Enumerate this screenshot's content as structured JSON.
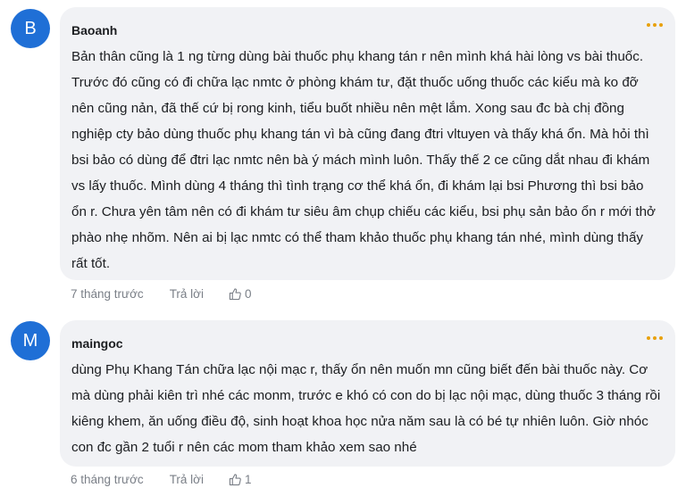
{
  "comments": [
    {
      "avatar_letter": "B",
      "author": "Baoanh",
      "text": "Bản thân cũng là 1 ng từng dùng bài thuốc phụ khang tán r nên mình khá hài lòng vs bài thuốc. Trước đó cũng có đi chữa lạc nmtc ở phòng khám tư, đặt thuốc uống thuốc các kiểu mà ko đỡ nên cũng nản, đã thế cứ bị rong kinh, tiểu buốt nhiều nên mệt lắm. Xong sau đc bà chị đồng nghiệp cty bảo dùng thuốc phụ khang tán vì bà cũng đang đtri vltuyen và thấy khá ổn. Mà hỏi thì bsi bảo có dùng để đtri lạc nmtc nên bà ý mách mình luôn. Thấy thế 2 ce cũng dắt nhau đi khám vs lấy thuốc. Mình dùng 4 tháng thì tình trạng cơ thể khá ổn, đi khám lại bsi Phương thì bsi bảo ổn r. Chưa yên tâm nên có đi khám tư siêu âm chụp chiếu các kiểu, bsi phụ sản bảo ổn r mới thở phào nhẹ nhõm. Nên ai bị lạc nmtc có thể tham khảo thuốc phụ khang tán nhé, mình dùng thấy rất tốt.",
      "time": "7 tháng trước",
      "reply_label": "Trả lời",
      "likes": "0"
    },
    {
      "avatar_letter": "M",
      "author": "maingoc",
      "text": "dùng Phụ Khang Tán chữa lạc nội mạc r, thấy ổn nên muốn mn cũng biết đến bài thuốc này. Cơ mà dùng phải kiên trì nhé các monm, trước e khó có con do bị lạc nội mạc, dùng thuốc 3 tháng rồi kiêng khem, ăn uống điều độ, sinh hoạt khoa học nửa năm sau là có bé tự nhiên luôn. Giờ nhóc con đc gần 2 tuổi r nên các mom tham khảo xem sao nhé",
      "time": "6 tháng trước",
      "reply_label": "Trả lời",
      "likes": "1"
    }
  ],
  "colors": {
    "avatar": "#1f6fd6",
    "bubble": "#f1f2f5",
    "more_dots": "#e8a10c",
    "meta": "#7a7f87"
  }
}
